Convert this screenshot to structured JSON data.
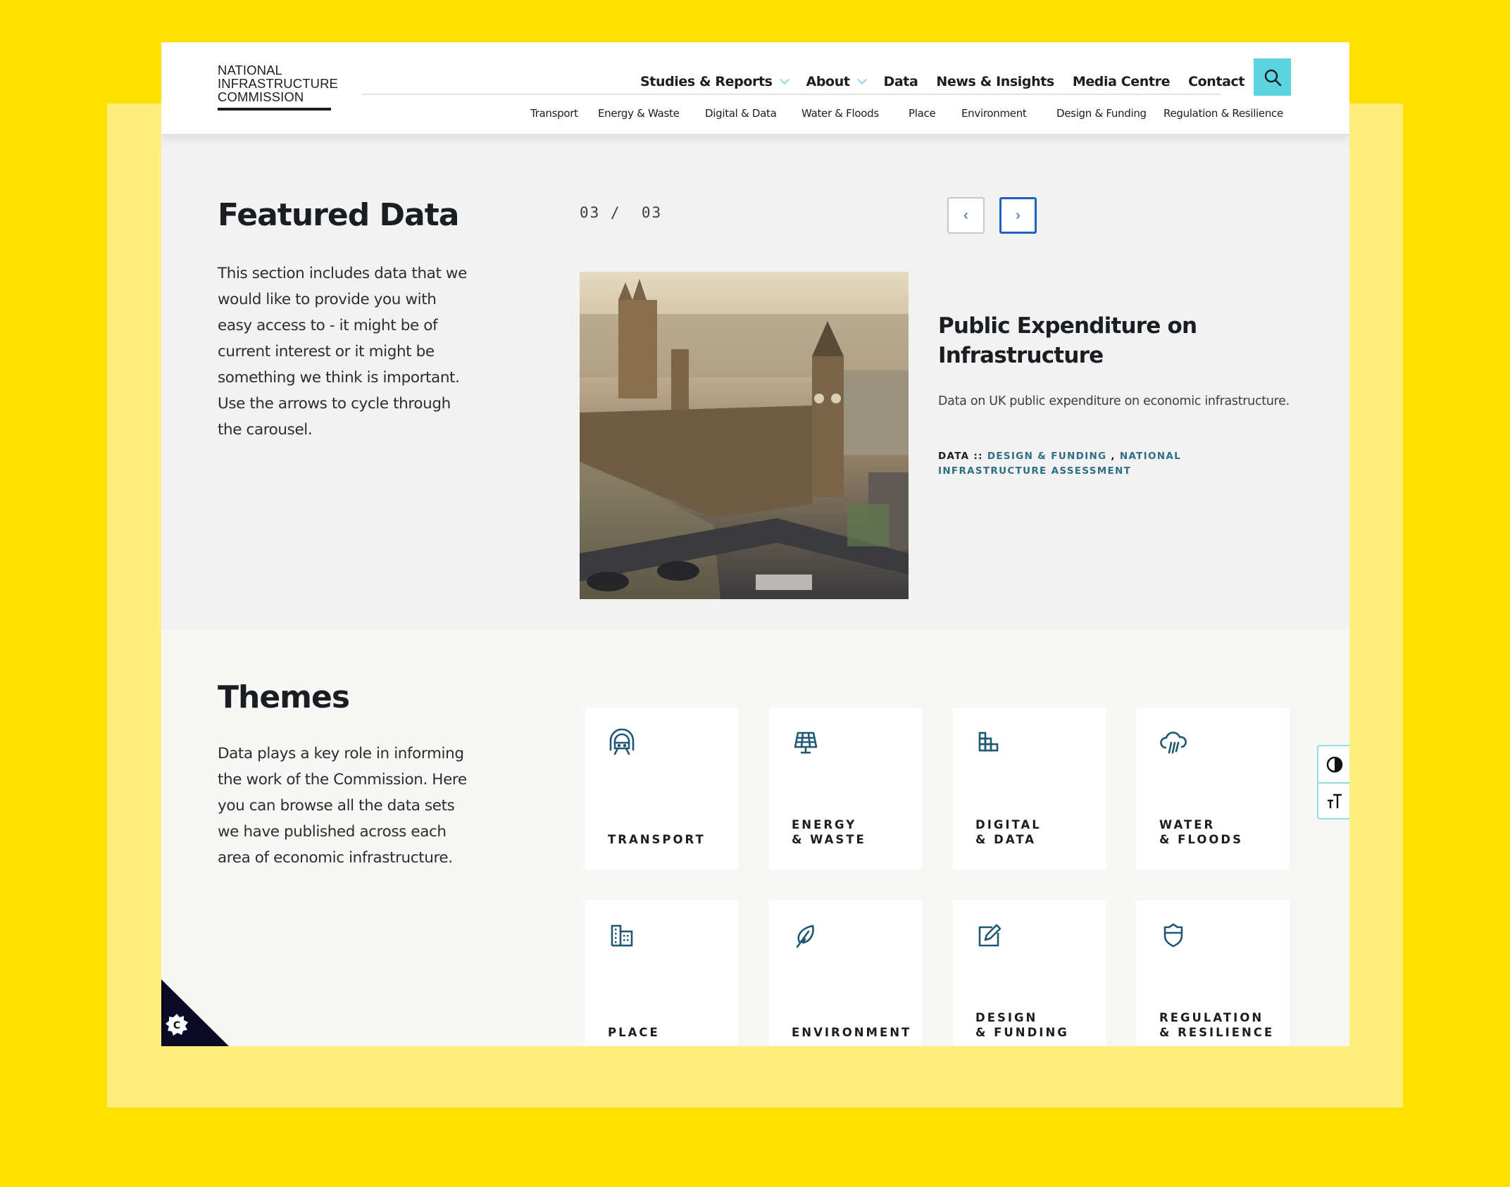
{
  "colors": {
    "outer_background": "#FFE000",
    "frame_background": "#FDEE7E",
    "search_accent": "#5BD4E0",
    "icon_color": "#1F5874",
    "tag_link_color": "#2F6E86",
    "active_arrow_border": "#1F5FC2"
  },
  "logo": {
    "lines": [
      "NATIONAL",
      "INFRASTRUCTURE",
      "COMMISSION"
    ]
  },
  "main_nav": [
    {
      "label": "Studies & Reports",
      "has_dropdown": true
    },
    {
      "label": "About",
      "has_dropdown": true
    },
    {
      "label": "Data",
      "has_dropdown": false
    },
    {
      "label": "News & Insights",
      "has_dropdown": false
    },
    {
      "label": "Media Centre",
      "has_dropdown": false
    },
    {
      "label": "Contact",
      "has_dropdown": false
    }
  ],
  "search": {
    "icon": "search-icon"
  },
  "sub_nav": [
    "Transport",
    "Energy & Waste",
    "Digital & Data",
    "Water & Floods",
    "Place",
    "Environment",
    "Design & Funding",
    "Regulation & Resilience"
  ],
  "featured": {
    "title": "Featured Data",
    "description_lines": [
      "This section includes data that we",
      "would like to provide you with",
      "easy access to - it might be of",
      "current interest or it might be",
      "something we think is important.",
      "Use the arrows to cycle through",
      "the carousel."
    ],
    "counter": "03 /  03",
    "prev_label": "‹",
    "next_label": "›",
    "card": {
      "image_alt": "Aerial view of the Houses of Parliament, Big Ben and Westminster Bridge",
      "title_lines": [
        "Public Expenditure on",
        "Infrastructure"
      ],
      "description": "Data on UK public expenditure on economic infrastructure.",
      "tag_prefix": "DATA :: ",
      "tags": [
        "DESIGN & FUNDING",
        "NATIONAL INFRASTRUCTURE ASSESSMENT"
      ],
      "tag_separator": " , "
    }
  },
  "themes": {
    "title": "Themes",
    "description_lines": [
      "Data plays a key role in informing",
      "the work of the Commission. Here",
      "you can browse all the data sets",
      "we have published across each",
      "area of economic infrastructure."
    ],
    "items": [
      {
        "label": "TRANSPORT",
        "icon": "train-icon"
      },
      {
        "label": "ENERGY\n& WASTE",
        "icon": "solar-panel-icon"
      },
      {
        "label": "DIGITAL\n& DATA",
        "icon": "data-blocks-icon"
      },
      {
        "label": "WATER\n& FLOODS",
        "icon": "rain-cloud-icon"
      },
      {
        "label": "PLACE",
        "icon": "buildings-icon"
      },
      {
        "label": "ENVIRONMENT",
        "icon": "leaf-icon"
      },
      {
        "label": "DESIGN\n& FUNDING",
        "icon": "edit-pencil-icon"
      },
      {
        "label": "REGULATION\n& RESILIENCE",
        "icon": "shield-icon"
      }
    ]
  },
  "accessibility": {
    "contrast_icon": "contrast-icon",
    "text_size_icon": "text-size-icon"
  },
  "cookie_badge": {
    "icon": "cookie-settings-icon",
    "glyph": "C"
  }
}
